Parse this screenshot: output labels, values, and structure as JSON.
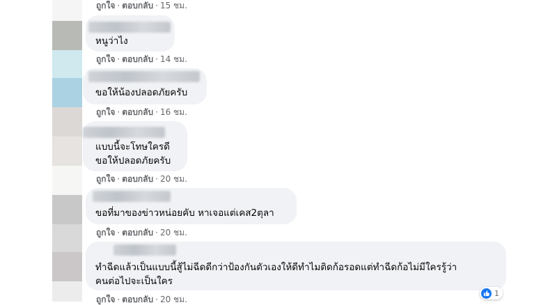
{
  "actions": {
    "like": "ถูกใจ",
    "reply": "ตอบกลับ",
    "separator": "·"
  },
  "comments": [
    {
      "lines": [],
      "time": "15 ชม."
    },
    {
      "lines": [
        "หนูว่าไง"
      ],
      "time": "14 ชม."
    },
    {
      "lines": [
        "ขอให้น้องปลอดภัยครับ"
      ],
      "time": "16 ชม."
    },
    {
      "lines": [
        "แบบนี้จะโทษใครดี",
        "ขอให้ปลอดภัยครับ"
      ],
      "time": "20 ชม."
    },
    {
      "lines": [
        "ขอที่มาของข่าวหน่อยคับ หาเจอแต่เคส2ตุลา"
      ],
      "time": "20 ชม."
    },
    {
      "lines": [
        "ทำฉีดแล้วเป็นแบบนี้สู้ไม่ฉีดดีกว่าป้องกันตัวเองให้ดีทำไมติดก้อรอดแต่ทำฉีดก้อไม่มีใครรู้ว่า",
        "คนต่อไปจะเป็นใคร"
      ],
      "time": "20 ชม.",
      "reaction_count": "1"
    }
  ],
  "colors": {
    "bubble": "#f0f2f5",
    "meta": "#65676b",
    "like": "#1877f2"
  }
}
